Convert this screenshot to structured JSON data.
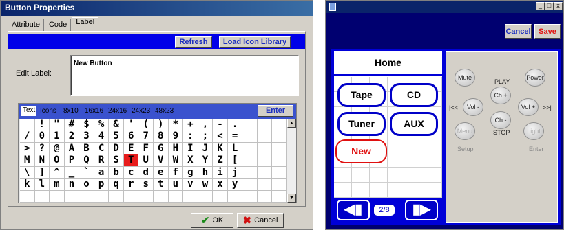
{
  "dialog": {
    "title": "Button Properties",
    "tabs": [
      "Attribute",
      "Code",
      "Label"
    ],
    "refresh_label": "Refresh",
    "load_icon_label": "Load Icon Library",
    "edit_label_caption": "Edit Label:",
    "edit_label_value": "New Button",
    "char_tabs": [
      "Text",
      "Icons",
      "8x10",
      "16x16",
      "24x16",
      "24x23",
      "48x23"
    ],
    "enter_label": "Enter",
    "char_rows": [
      [
        " ",
        "!",
        "\"",
        "#",
        "$",
        "%",
        "&",
        "'",
        "(",
        ")",
        "*",
        "+",
        ",",
        "-",
        ".",
        " ",
        " ",
        " "
      ],
      [
        "/",
        "0",
        "1",
        "2",
        "3",
        "4",
        "5",
        "6",
        "7",
        "8",
        "9",
        ":",
        ";",
        "<",
        "=",
        " ",
        " ",
        " "
      ],
      [
        ">",
        "?",
        "@",
        "A",
        "B",
        "C",
        "D",
        "E",
        "F",
        "G",
        "H",
        "I",
        "J",
        "K",
        "L",
        " ",
        " ",
        " "
      ],
      [
        "M",
        "N",
        "O",
        "P",
        "Q",
        "R",
        "S",
        "T",
        "U",
        "V",
        "W",
        "X",
        "Y",
        "Z",
        "[",
        " ",
        " ",
        " "
      ],
      [
        "\\",
        "]",
        "^",
        "_",
        "`",
        "a",
        "b",
        "c",
        "d",
        "e",
        "f",
        "g",
        "h",
        "i",
        "j",
        " ",
        " ",
        " "
      ],
      [
        "k",
        "l",
        "m",
        "n",
        "o",
        "p",
        "q",
        "r",
        "s",
        "t",
        "u",
        "v",
        "w",
        "x",
        "y",
        " ",
        " ",
        " "
      ],
      [
        " ",
        " ",
        " ",
        " ",
        " ",
        " ",
        " ",
        " ",
        " ",
        " ",
        " ",
        " ",
        " ",
        " ",
        " ",
        " ",
        " ",
        " "
      ]
    ],
    "highlight_char": "T",
    "ok_label": "OK",
    "cancel_label": "Cancel"
  },
  "remote": {
    "window_controls": [
      "_",
      "□",
      "x"
    ],
    "cancel_label": "Cancel",
    "save_label": "Save",
    "home_label": "Home",
    "source_buttons": [
      "Tape",
      "CD",
      "Tuner",
      "AUX"
    ],
    "new_label": "New",
    "page_indicator": "2/8",
    "controls": {
      "mute": "Mute",
      "power": "Power",
      "play": "PLAY",
      "ch_up": "Ch +",
      "vol_down": "Vol -",
      "vol_up": "Vol +",
      "prev": "|<<",
      "next": ">>|",
      "ch_down": "Ch -",
      "stop": "STOP",
      "menu": "Menu",
      "light": "Light",
      "setup": "Setup",
      "enter": "Enter"
    }
  },
  "colors": {
    "brand_blue": "#0000d8",
    "save_red": "#e01010",
    "highlight_red": "#e81c1c",
    "ok_green": "#1a8a1a"
  }
}
